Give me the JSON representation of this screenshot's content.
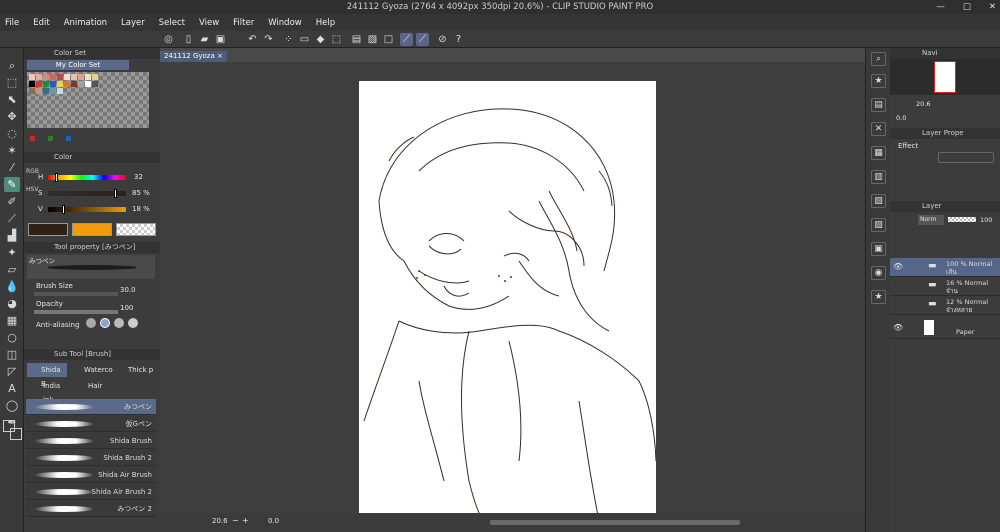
{
  "window": {
    "title": "241112 Gyoza (2764 x 4092px 350dpi 20.6%) - CLIP STUDIO PAINT PRO",
    "buttons": [
      "—",
      "□",
      "✕"
    ]
  },
  "menu": [
    "File",
    "Edit",
    "Animation",
    "Layer",
    "Select",
    "View",
    "Filter",
    "Window",
    "Help"
  ],
  "color_set": {
    "tab": "Color Set",
    "name": "My Color Set",
    "swatches": [
      "#f2c6c0",
      "#e8a99f",
      "#d9887a",
      "#c96a5e",
      "#b34d45",
      "#f7dcd2",
      "#ecc0b0",
      "#e0a48f",
      "#f3e3c0",
      "#e6cc95",
      "#000000",
      "#d6382d",
      "#1f8f2f",
      "#2b59c9",
      "#e8d44a",
      "#d97a2b",
      "#7a3b2a",
      "#9aa8a0",
      "#ffffff",
      "#555555",
      "#8c6b5a",
      "#b89a80",
      "#3d6a8c",
      "#6a9c9a",
      "#c7d8e6"
    ],
    "bottom_colors": [
      "#c62828",
      "#2e7d32",
      "#1565c0"
    ]
  },
  "color_panel": {
    "tab": "Color",
    "side_tabs": [
      "HSV",
      "RGB"
    ],
    "h_label": "H",
    "s_label": "S",
    "v_label": "V",
    "h_value": "32",
    "s_value": "85 %",
    "v_value": "18 %",
    "h_level": 0.09,
    "s_level": 0.85,
    "v_level": 0.18,
    "main_color": "#2e2217",
    "sub_color": "#f29b0c"
  },
  "tool_property": {
    "title": "Tool property [みつペン]",
    "brush_name": "みつペン",
    "brush_size_label": "Brush Size",
    "brush_size": "30.0",
    "opacity_label": "Opacity",
    "opacity": "100",
    "anti_aliasing_label": "Anti-aliasing"
  },
  "sub_tool": {
    "title": "Sub Tool [Brush]",
    "tabs": [
      "Shida B",
      "Waterco",
      "Thick p",
      "India ink",
      "Hair"
    ],
    "items": [
      "みつペン",
      "仮Gペン",
      "Shida Brush",
      "Shida Brush 2",
      "Shida Air Brush",
      "Shida Air Brush 2",
      "みつペン 2"
    ]
  },
  "document": {
    "tab": "241112 Gyoza",
    "close": "×",
    "zoom": "20.6",
    "angle": "0.0"
  },
  "navigator": {
    "tab": "Navi",
    "zoom": "20.6",
    "angle": "0.0"
  },
  "layer_property": {
    "tab": "Layer Prope",
    "effect_label": "Effect"
  },
  "layer_panel": {
    "tab": "Layer",
    "blend": "Norm",
    "opacity": "100",
    "layers": [
      {
        "line1": "100 % Normal",
        "line2": "เส้น",
        "selected": true,
        "visible": true
      },
      {
        "line1": "16 % Normal",
        "line2": "จ๋าน",
        "selected": false,
        "visible": false
      },
      {
        "line1": "12 % Normal",
        "line2": "จ๋างหลาย",
        "selected": false,
        "visible": false
      },
      {
        "line1": "",
        "line2": "Paper",
        "selected": false,
        "visible": true
      }
    ]
  },
  "colors": {
    "accent": "#56658a",
    "tool_active": "#4b8c7d"
  }
}
